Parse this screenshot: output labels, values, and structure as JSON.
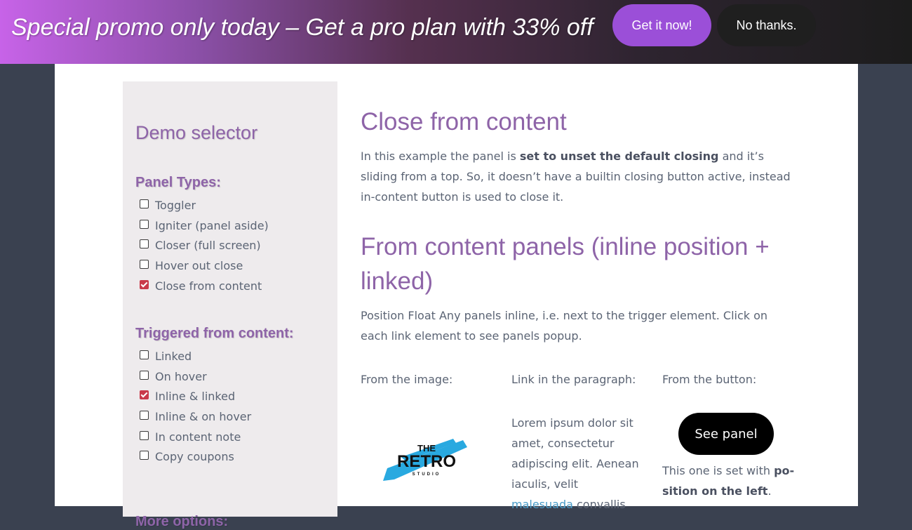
{
  "promo": {
    "text": "Special promo only today – Get a pro plan with 33% off",
    "cta_label": "Get it now!",
    "dismiss_label": "No thanks.",
    "cta_color": "#9b4fd8"
  },
  "sidebar": {
    "title": "Demo selector",
    "sections": [
      {
        "heading": "Panel Types:",
        "items": [
          {
            "label": "Toggler",
            "checked": false
          },
          {
            "label": "Igniter (panel aside)",
            "checked": false
          },
          {
            "label": "Closer (full screen)",
            "checked": false
          },
          {
            "label": "Hover out close",
            "checked": false
          },
          {
            "label": "Close from content",
            "checked": true
          }
        ]
      },
      {
        "heading": "Triggered from content:",
        "items": [
          {
            "label": "Linked",
            "checked": false
          },
          {
            "label": "On hover",
            "checked": false
          },
          {
            "label": "Inline & linked",
            "checked": true
          },
          {
            "label": "Inline & on hover",
            "checked": false
          },
          {
            "label": "In content note",
            "checked": false
          },
          {
            "label": "Copy coupons",
            "checked": false
          }
        ]
      },
      {
        "heading": "More options:",
        "items": []
      }
    ]
  },
  "main": {
    "title": "Close from content",
    "intro": {
      "before": "In this example the panel is ",
      "bold": "set to unset the default closing",
      "after": " and it’s sliding from a top. So, it doesn’t have a builtin closing button active, instead in-content button is used to close it."
    },
    "section_title": "From content panels (inline position + linked)",
    "section_text": "Position Float Any panels inline, i.e. next to the trigger element. Click on each link element to see panels popup.",
    "columns": {
      "image_label": "From the image:",
      "paragraph_label": "Link in the paragraph:",
      "button_label": "From the button:"
    },
    "logo": {
      "line1": "THE",
      "line2": "RETRO",
      "line3": "STUDIO"
    },
    "lorem": {
      "text": "Lorem ipsum dolor sit amet, consectetur adip­iscing elit. Aenean iac­ulis, velit ",
      "link": "malesuada",
      "after": " convallis"
    },
    "see_panel_label": "See panel",
    "button_note": {
      "before": "This one is set with ",
      "bold": "po­sition on the left",
      "after": "."
    }
  },
  "colors": {
    "accent": "#8e64a8",
    "text": "#5b6474",
    "check": "#c93a4a",
    "link": "#4a9cc8"
  }
}
